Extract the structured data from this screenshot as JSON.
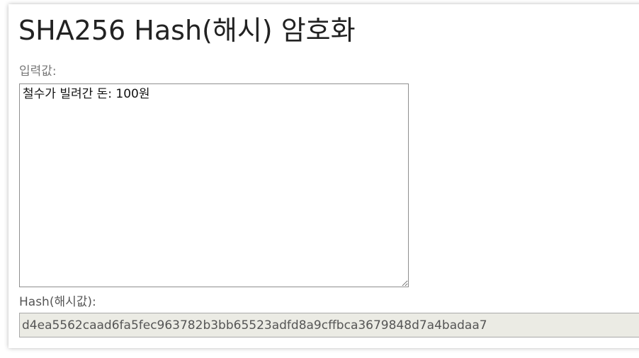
{
  "page": {
    "title": "SHA256 Hash(해시) 암호화"
  },
  "input": {
    "label": "입력값:",
    "value": "철수가 빌려간 돈: 100원"
  },
  "hash": {
    "label": "Hash(해시값):",
    "value": "d4ea5562caad6fa5fec963782b3bb65523adfd8a9cffbca3679848d7a4badaa7"
  },
  "colors": {
    "hash_background": "#ebebe4",
    "label_text": "#777777",
    "title_text": "#222222"
  }
}
